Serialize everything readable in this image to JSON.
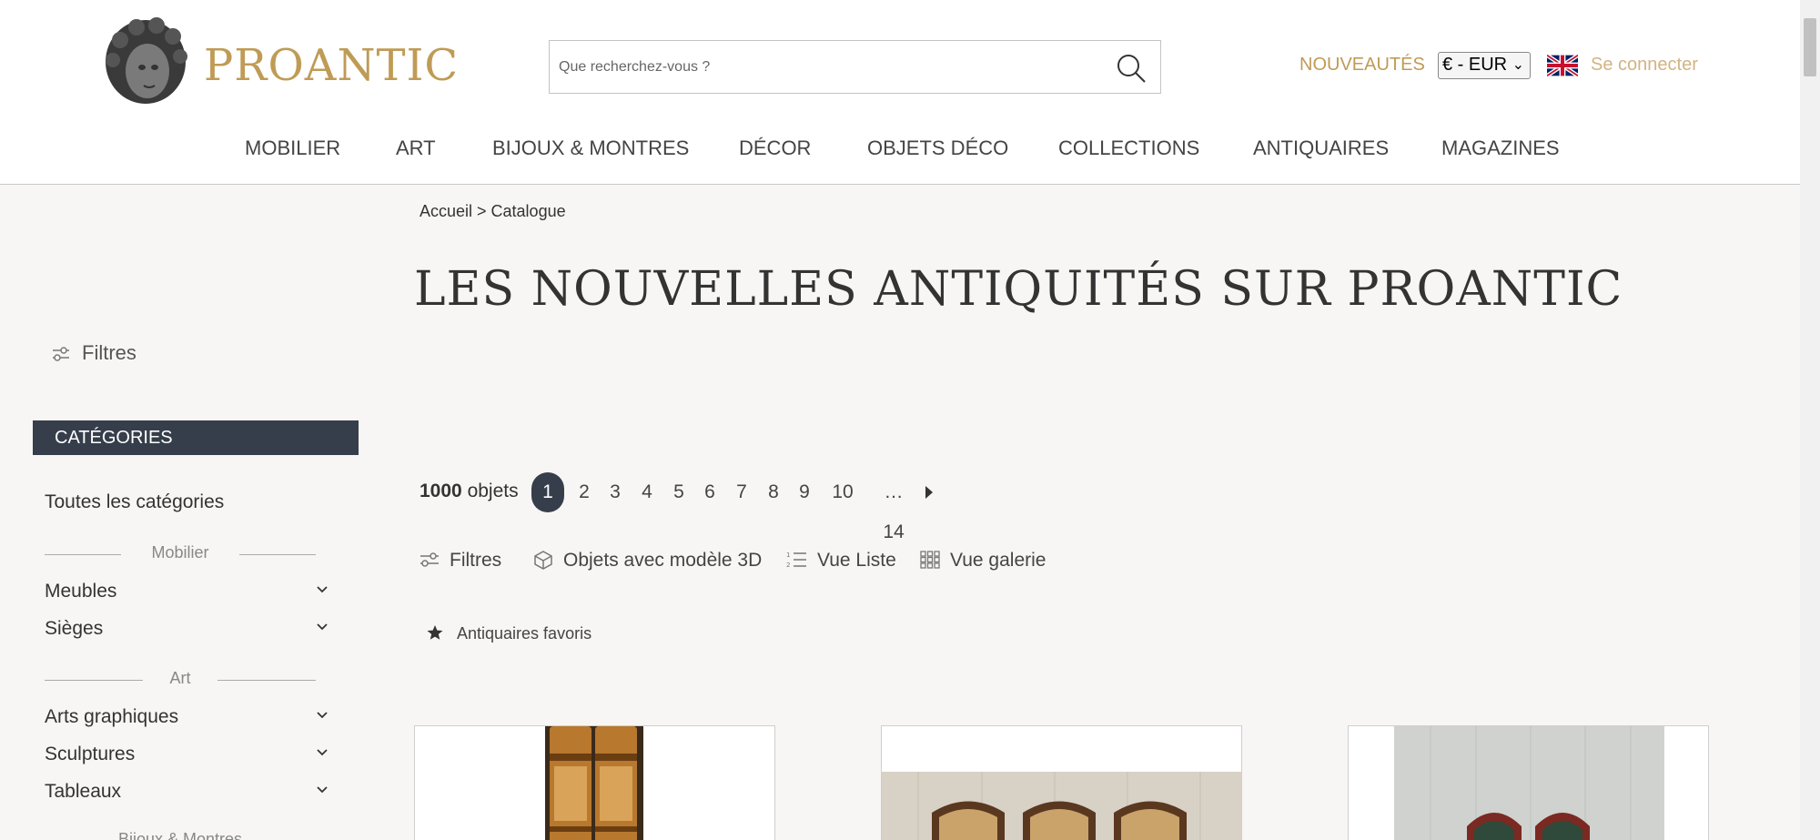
{
  "header": {
    "brand": "PROANTIC",
    "search_placeholder": "Que recherchez-vous ?",
    "nouveautes": "NOUVEAUTÉS",
    "currency": "€ - EUR",
    "login": "Se connecter"
  },
  "nav": [
    "MOBILIER",
    "ART",
    "BIJOUX & MONTRES",
    "DÉCOR",
    "OBJETS DÉCO",
    "COLLECTIONS",
    "ANTIQUAIRES",
    "MAGAZINES"
  ],
  "breadcrumb": "Accueil > Catalogue",
  "page_title": "LES NOUVELLES ANTIQUITÉS SUR PROANTIC",
  "sidebar": {
    "filters_label": "Filtres",
    "categories_header": "CATÉGORIES",
    "all_categories": "Toutes les catégories",
    "section_mobilier": "Mobilier",
    "section_art": "Art",
    "section_bijoux": "Bijoux & Montres",
    "items": [
      "Meubles",
      "Sièges",
      "Arts graphiques",
      "Sculptures",
      "Tableaux"
    ]
  },
  "results": {
    "count": "1000",
    "count_label": "objets",
    "pages": [
      "1",
      "2",
      "3",
      "4",
      "5",
      "6",
      "7",
      "8",
      "9",
      "10"
    ],
    "last_page": "… 14"
  },
  "toolbar": {
    "filters": "Filtres",
    "objects_3d": "Objets avec modèle 3D",
    "list_view": "Vue Liste",
    "gallery_view": "Vue galerie",
    "favorites": "Antiquaires favoris"
  },
  "colors": {
    "gold": "#bf9b55",
    "dark": "#363e4b",
    "background": "#f7f6f4"
  }
}
